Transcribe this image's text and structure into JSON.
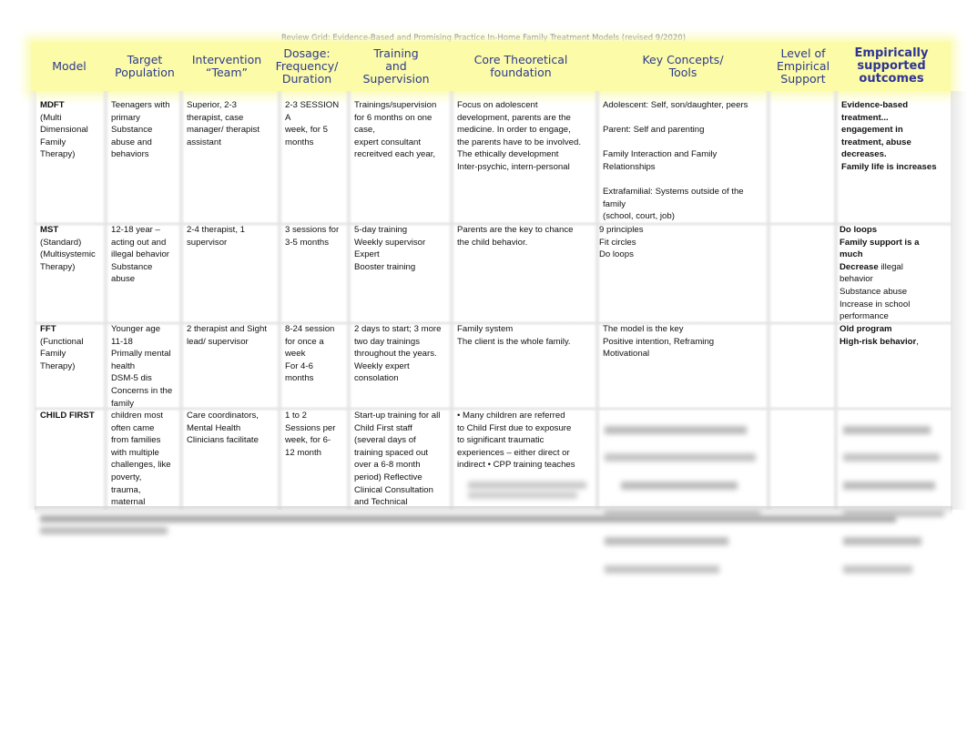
{
  "document": {
    "title": "Review Grid:  Evidence-Based and Promising Practice In-Home Family Treatment Models (revised 9/2020)",
    "header_bg_color": "#fbfba8",
    "header_text_color": "#2e3a8c"
  },
  "headers": [
    {
      "label": "Model"
    },
    {
      "label": "Target\nPopulation"
    },
    {
      "label": "Intervention\n“Team”"
    },
    {
      "label": "Dosage:\nFrequency/\nDuration"
    },
    {
      "label": "Training\nand\nSupervision"
    },
    {
      "label": "Core Theoretical\nfoundation"
    },
    {
      "label": "Key Concepts/\nTools"
    },
    {
      "label": "Level of\nEmpirical\nSupport"
    },
    {
      "label": "Empirically\nsupported\noutcomes"
    }
  ],
  "rows": [
    {
      "model_name": "MDFT",
      "model_desc": "(Multi\nDimensional\nFamily\nTherapy)",
      "target": "Teenagers with\nprimary\nSubstance\nabuse and\nbehaviors",
      "team": "Superior, 2-3\ntherapist, case\nmanager/ therapist\nassistant",
      "dosage": "2-3 SESSION A\nweek, for 5\nmonths",
      "training": "Trainings/supervision\nfor 6 months on one\ncase,\nexpert consultant\nrecreitved each year,",
      "core": "Focus on adolescent\ndevelopment, parents are the\nmedicine. In order to engage,\nthe parents have to be involved.\nThe ethically development\nInter-psychic, intern-personal",
      "key": "Adolescent: Self, son/daughter, peers\n\nParent: Self and parenting\n\nFamily Interaction and Family\nRelationships\n\nExtrafamilial: Systems outside of the\nfamily\n(school, court, job)",
      "level": "",
      "outcomes_bold": "Evidence-based\ntreatment...\nengagement in\ntreatment, abuse\ndecreases.\nFamily life is increases",
      "outcomes_rest": ""
    },
    {
      "model_name": "MST",
      "model_desc": "(Standard)\n(Multisystemic\nTherapy)",
      "target": "12-18 year –\nacting out and\nillegal behavior\nSubstance\nabuse",
      "team": "2-4 therapist, 1\nsupervisor",
      "dosage": "3 sessions for\n3-5 months",
      "training": "5-day training\nWeekly supervisor\nExpert\nBooster training",
      "core": "Parents are the key to chance\nthe child behavior.",
      "key": "9 principles\nFit circles\nDo loops",
      "level": "",
      "outcomes_bold": " Do loops\n Family support is a\n much\nDecrease",
      "outcomes_rest": " illegal\nbehavior\n Substance abuse\n Increase in school\n performance"
    },
    {
      "model_name": "FFT",
      "model_desc": "(Functional\nFamily\nTherapy)",
      "target": "Younger age\n11-18\nPrimally mental\nhealth\nDSM-5 dis\nConcerns in the\nfamily",
      "team": "2 therapist and Sight\nlead/ supervisor",
      "dosage": "8-24 session\nfor once a\nweek\nFor 4-6\nmonths",
      "training": "2 days to start; 3 more\ntwo day trainings\nthroughout the years.\nWeekly expert\nconsolation",
      "core": "Family system\nThe client is the whole family.",
      "key": "The model is the key\nPositive intention, Reframing\nMotivational",
      "level": "",
      "outcomes_bold": "Old program\nHigh-risk behavior",
      "outcomes_rest": ","
    },
    {
      "model_name": "CHILD FIRST",
      "model_desc": "",
      "target": "children most\noften came\nfrom families\nwith multiple\nchallenges, like\npoverty,\ntrauma,\nmaternal",
      "team": "Care coordinators,\nMental Health\nClinicians facilitate",
      "dosage": "1 to 2\nSessions per\nweek, for 6-\n12 month",
      "training": "Start-up training for all\nChild First staff\n(several days of\ntraining spaced out\nover a 6-8 month\nperiod) Reflective\nClinical Consultation\nand Technical",
      "core": "  • Many children are referred\n  to Child First due to exposure\n  to significant traumatic\n  experiences – either direct or\n  indirect • CPP training teaches",
      "key": "",
      "level": "",
      "outcomes_bold": "",
      "outcomes_rest": ""
    }
  ]
}
